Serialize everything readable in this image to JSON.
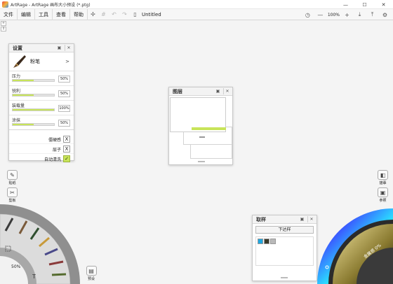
{
  "window": {
    "title": "ArtRage - ArtRage 画布大小预设 (*.ptg)",
    "controls": [
      "—",
      "☐",
      "✕"
    ]
  },
  "menubar": {
    "items": [
      "文件",
      "编辑",
      "工具",
      "查看",
      "帮助"
    ],
    "doc_name": "Untitled",
    "zoom": "100%",
    "zoom_minus": "—",
    "zoom_plus": "+"
  },
  "settings_panel": {
    "title": "设置",
    "brush_name": "粉笔",
    "brush_arrow": ">",
    "params": [
      {
        "label": "压力",
        "value": "50%",
        "level": 0.5
      },
      {
        "label": "锐利",
        "value": "50%",
        "level": 0.5
      },
      {
        "label": "装载量",
        "value": "100%",
        "level": 1.0
      },
      {
        "label": "涂抹",
        "value": "50%",
        "level": 0.5
      }
    ],
    "toggles": [
      {
        "label": "僵硬感",
        "mark": "X"
      },
      {
        "label": "层子",
        "mark": "X"
      },
      {
        "label": "自动清洗",
        "mark": "✓"
      }
    ]
  },
  "layers_panel": {
    "title": "图层"
  },
  "left_buttons": [
    {
      "label": "贴纸"
    },
    {
      "label": "型板"
    }
  ],
  "preset_button": {
    "label": "预设"
  },
  "right_buttons": [
    {
      "label": "描摹"
    },
    {
      "label": "参照"
    }
  ],
  "sampler_panel": {
    "title": "取样",
    "button": "下达样",
    "swatches": [
      "#1da7e0",
      "#3a3a2a",
      "#b9b9b9"
    ]
  },
  "brush_size": "50%",
  "color_readout": "金属感 0%",
  "colors": {
    "accent": "#c8e45a",
    "panel_bg": "#ffffff",
    "canvas_bg": "#f4f4f4"
  }
}
